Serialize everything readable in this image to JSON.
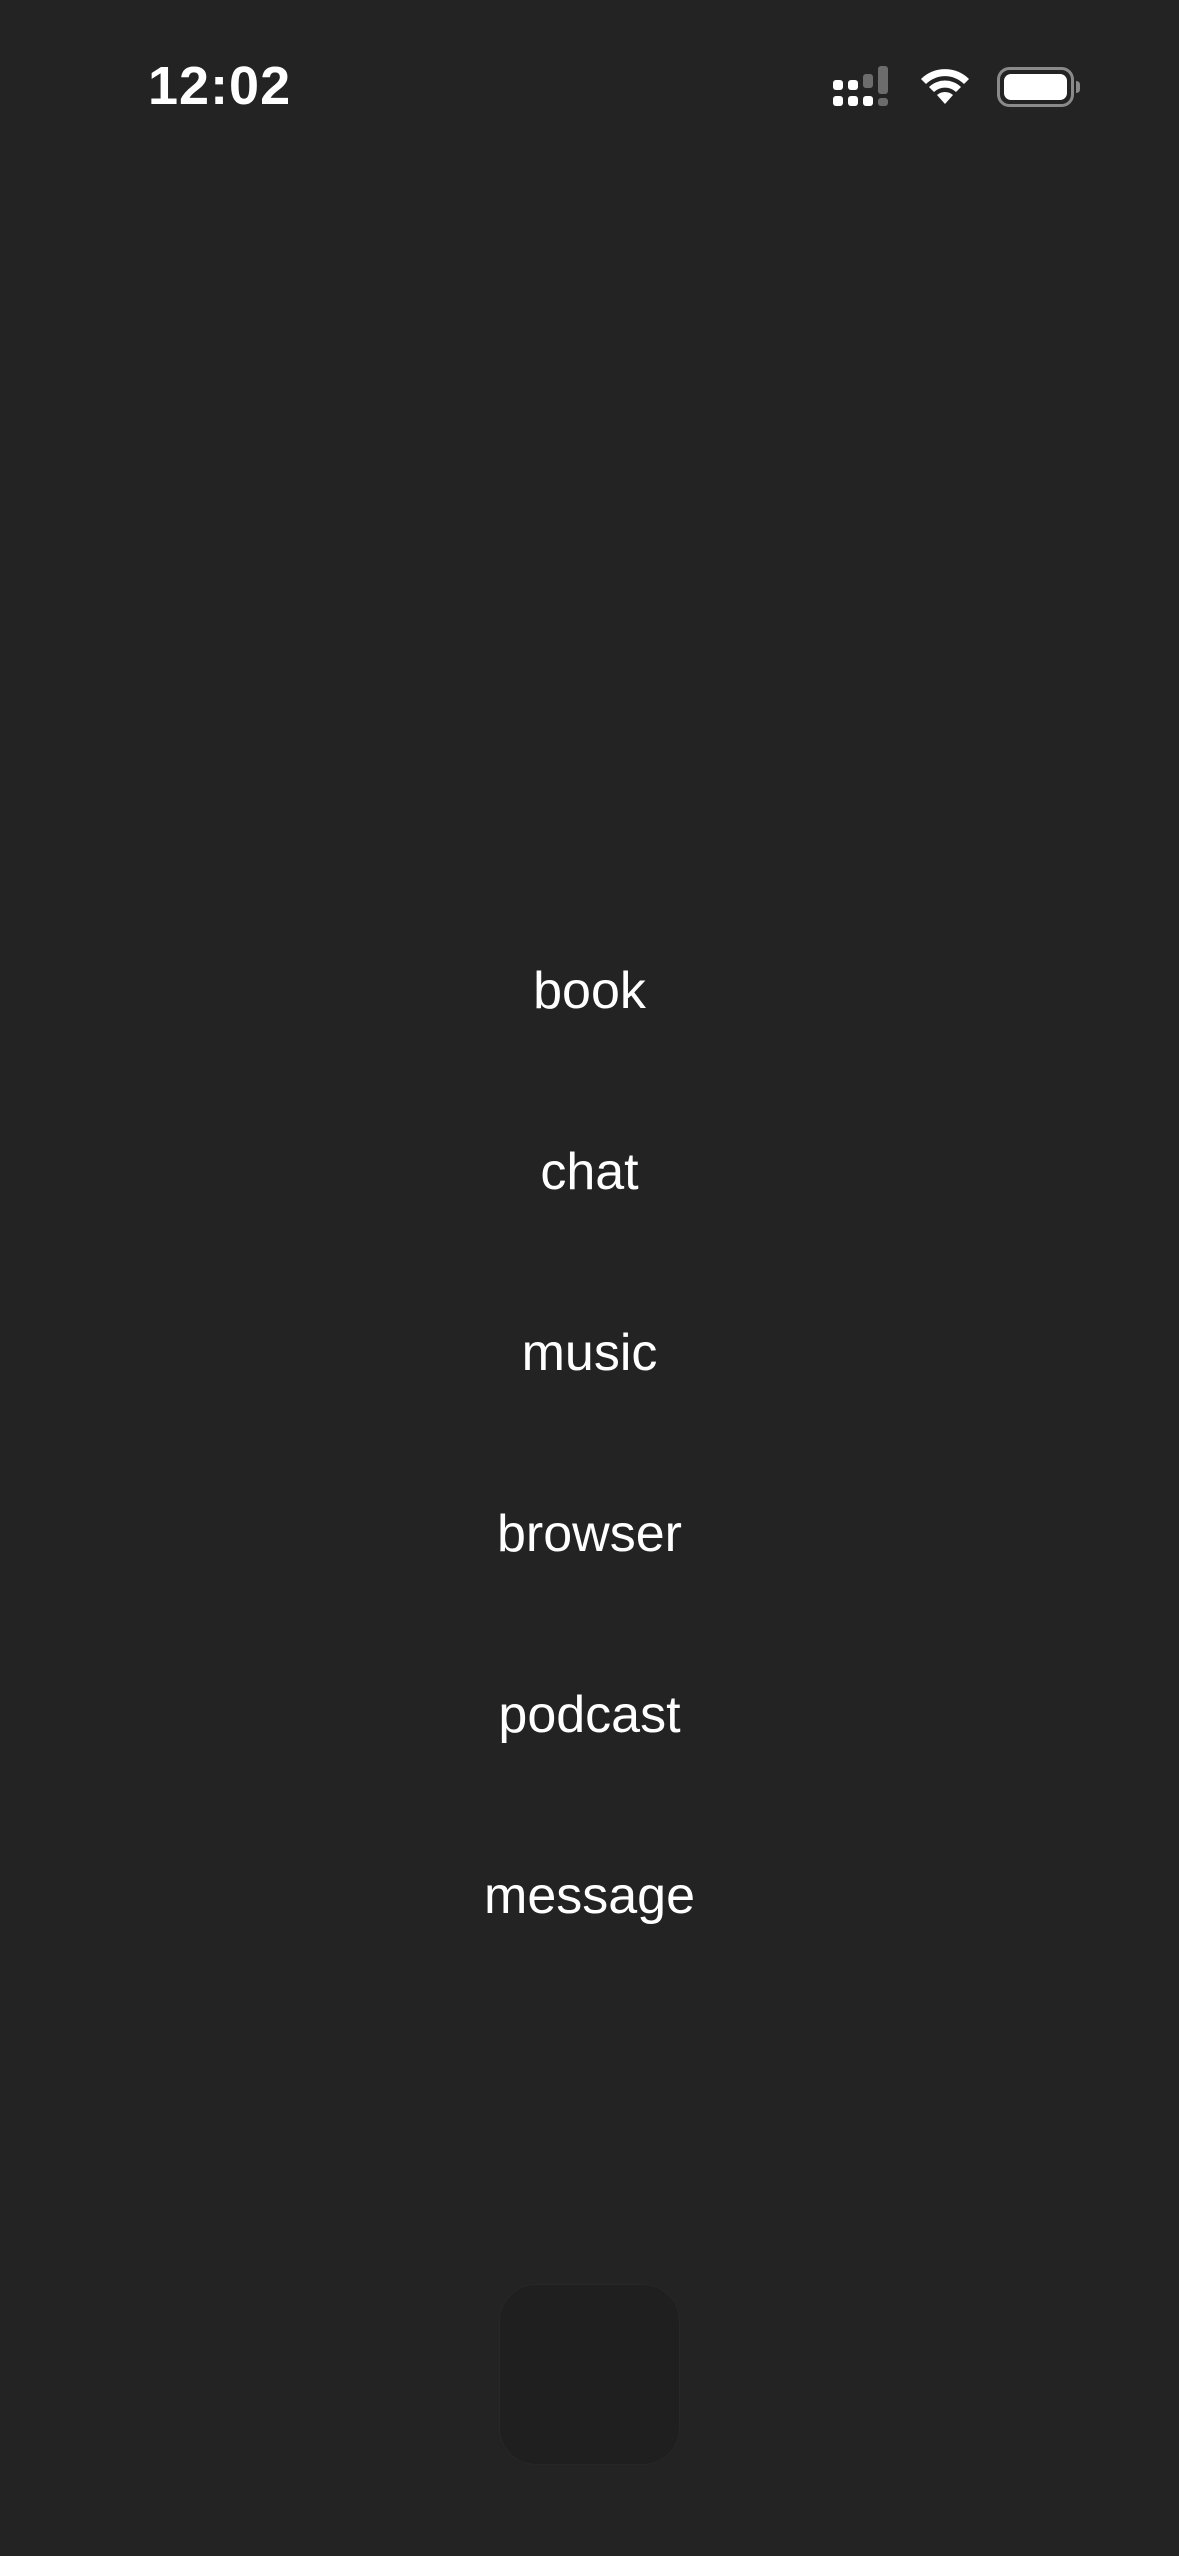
{
  "status_bar": {
    "time": "12:02",
    "icons": [
      "cellular-signal-icon",
      "wifi-icon",
      "battery-icon"
    ]
  },
  "menu": {
    "items": [
      {
        "label": "book"
      },
      {
        "label": "chat"
      },
      {
        "label": "music"
      },
      {
        "label": "browser"
      },
      {
        "label": "podcast"
      },
      {
        "label": "message"
      }
    ]
  },
  "colors": {
    "background": "#232323",
    "text": "#ffffff",
    "button_surface": "#1f1f1f"
  }
}
